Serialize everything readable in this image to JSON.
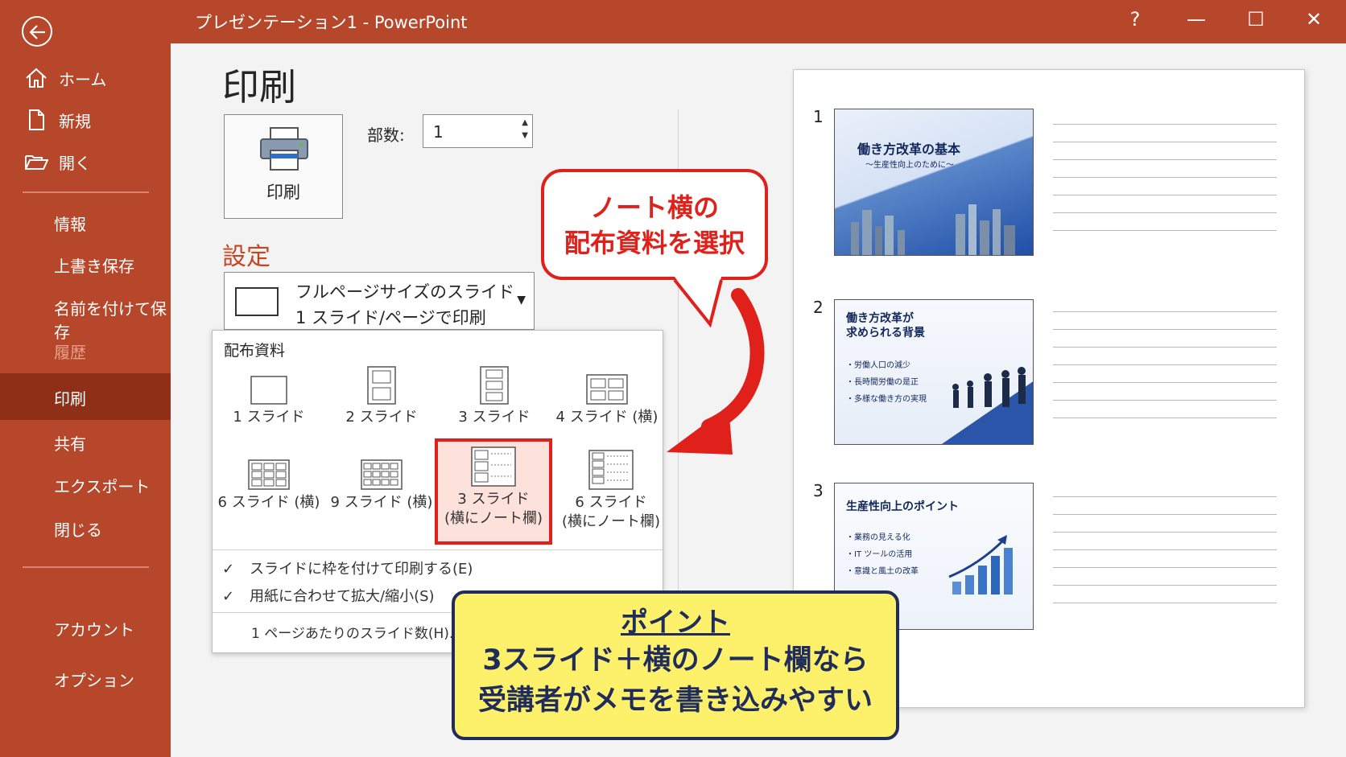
{
  "window": {
    "title": "プレゼンテーション1  -  PowerPoint",
    "help": "?",
    "minimize": "—",
    "maximize": "☐",
    "close": "✕"
  },
  "sidebar": {
    "items": [
      {
        "label": "ホーム"
      },
      {
        "label": "新規"
      },
      {
        "label": "開く"
      },
      {
        "label": "情報"
      },
      {
        "label": "上書き保存"
      },
      {
        "label": "名前を付けて保存"
      },
      {
        "label": "履歴"
      },
      {
        "label": "印刷"
      },
      {
        "label": "共有"
      },
      {
        "label": "エクスポート"
      },
      {
        "label": "閉じる"
      },
      {
        "label": "アカウント"
      },
      {
        "label": "オプション"
      }
    ]
  },
  "print": {
    "title": "印刷",
    "button": "印刷",
    "copies_label": "部数:",
    "copies_value": "1",
    "settings_heading": "設定",
    "layout_line1": "フルページサイズのスライド",
    "layout_line2": "1 スライド/ページで印刷"
  },
  "handouts": {
    "heading": "配布資料",
    "options": [
      {
        "label": "1 スライド"
      },
      {
        "label": "2 スライド"
      },
      {
        "label": "3 スライド"
      },
      {
        "label": "4 スライド (横)"
      },
      {
        "label": "6 スライド (横)"
      },
      {
        "label": "9 スライド (横)"
      },
      {
        "label1": "3 スライド",
        "label2": "(横にノート欄)",
        "selected": true
      },
      {
        "label1": "6 スライド",
        "label2": "(横にノート欄)"
      }
    ],
    "frame_slides": "スライドに枠を付けて印刷する(E)",
    "scale_to_fit": "用紙に合わせて拡大/縮小(S)",
    "slides_per_page": "1 ページあたりのスライド数(H)...",
    "check_mark": "✓"
  },
  "callout": {
    "line1": "ノート横の",
    "line2": "配布資料を選択"
  },
  "point": {
    "heading": "ポイント",
    "line1": "3スライド＋横のノート欄なら",
    "line2": "受講者がメモを書き込みやすい"
  },
  "preview": {
    "slides": [
      {
        "num": "1",
        "title": "働き方改革の基本",
        "subtitle": "～生産性向上のために～"
      },
      {
        "num": "2",
        "title1": "働き方改革が",
        "title2": "求められる背景",
        "bullets": [
          "・労働人口の減少",
          "・長時間労働の是正",
          "・多様な働き方の実現"
        ]
      },
      {
        "num": "3",
        "title": "生産性向上のポイント",
        "bullets": [
          "・業務の見える化",
          "・IT ツールの活用",
          "・意識と風土の改革"
        ]
      }
    ]
  },
  "colors": {
    "accent": "#b7472a",
    "active": "#8f2f17",
    "highlight": "#e0211b",
    "point_bg": "#fdf16c",
    "point_border": "#1f2c5c"
  }
}
